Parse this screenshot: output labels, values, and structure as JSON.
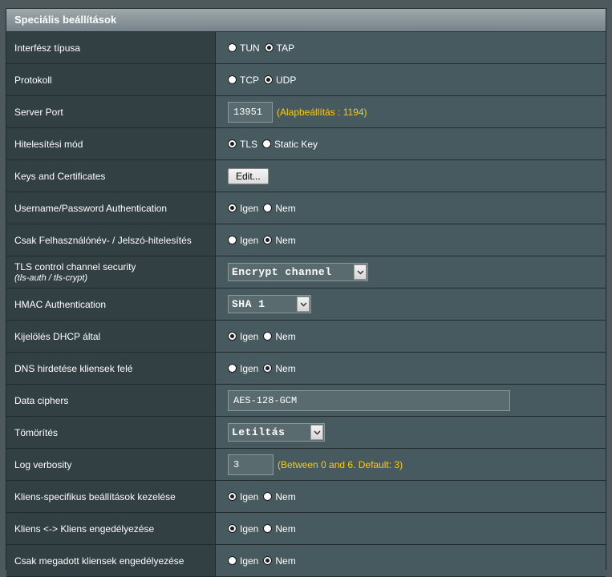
{
  "panel": {
    "title": "Speciális beállítások"
  },
  "rows": {
    "interface_type": {
      "label": "Interfész típusa",
      "options": [
        "TUN",
        "TAP"
      ]
    },
    "protocol": {
      "label": "Protokoll",
      "options": [
        "TCP",
        "UDP"
      ]
    },
    "server_port": {
      "label": "Server Port",
      "value": "13951",
      "note": "(Alapbeállítás : 1194)"
    },
    "auth_mode": {
      "label": "Hitelesítési mód",
      "options": [
        "TLS",
        "Static Key"
      ]
    },
    "keys": {
      "label": "Keys and Certificates",
      "button": "Edit..."
    },
    "user_pass_auth": {
      "label": "Username/Password Authentication",
      "options": [
        "Igen",
        "Nem"
      ]
    },
    "user_pass_only": {
      "label": "Csak Felhasználónév- / Jelszó-hitelesítés",
      "options": [
        "Igen",
        "Nem"
      ]
    },
    "tls_control": {
      "label": "TLS control channel security",
      "sublabel": "(tls-auth / tls-crypt)",
      "selected": "Encrypt channel"
    },
    "hmac": {
      "label": "HMAC Authentication",
      "selected": "SHA 1"
    },
    "dhcp": {
      "label": "Kijelölés DHCP által",
      "options": [
        "Igen",
        "Nem"
      ]
    },
    "dns": {
      "label": "DNS hirdetése kliensek felé",
      "options": [
        "Igen",
        "Nem"
      ]
    },
    "data_ciphers": {
      "label": "Data ciphers",
      "value": "AES-128-GCM"
    },
    "compression": {
      "label": "Tömörítés",
      "selected": "Letiltás"
    },
    "log_verbosity": {
      "label": "Log verbosity",
      "value": "3",
      "note": "(Between 0 and 6. Default: 3)"
    },
    "client_specific": {
      "label": "Kliens-specifikus beállítások kezelése",
      "options": [
        "Igen",
        "Nem"
      ]
    },
    "client_to_client": {
      "label": "Kliens <-> Kliens engedélyezése",
      "options": [
        "Igen",
        "Nem"
      ]
    },
    "only_specified": {
      "label": "Csak megadott kliensek engedélyezése",
      "options": [
        "Igen",
        "Nem"
      ]
    }
  },
  "colors": {
    "note": "#ffcc00",
    "label_bg": "#323f43",
    "value_bg": "#475a5f",
    "header_bg": "#8d989c"
  }
}
